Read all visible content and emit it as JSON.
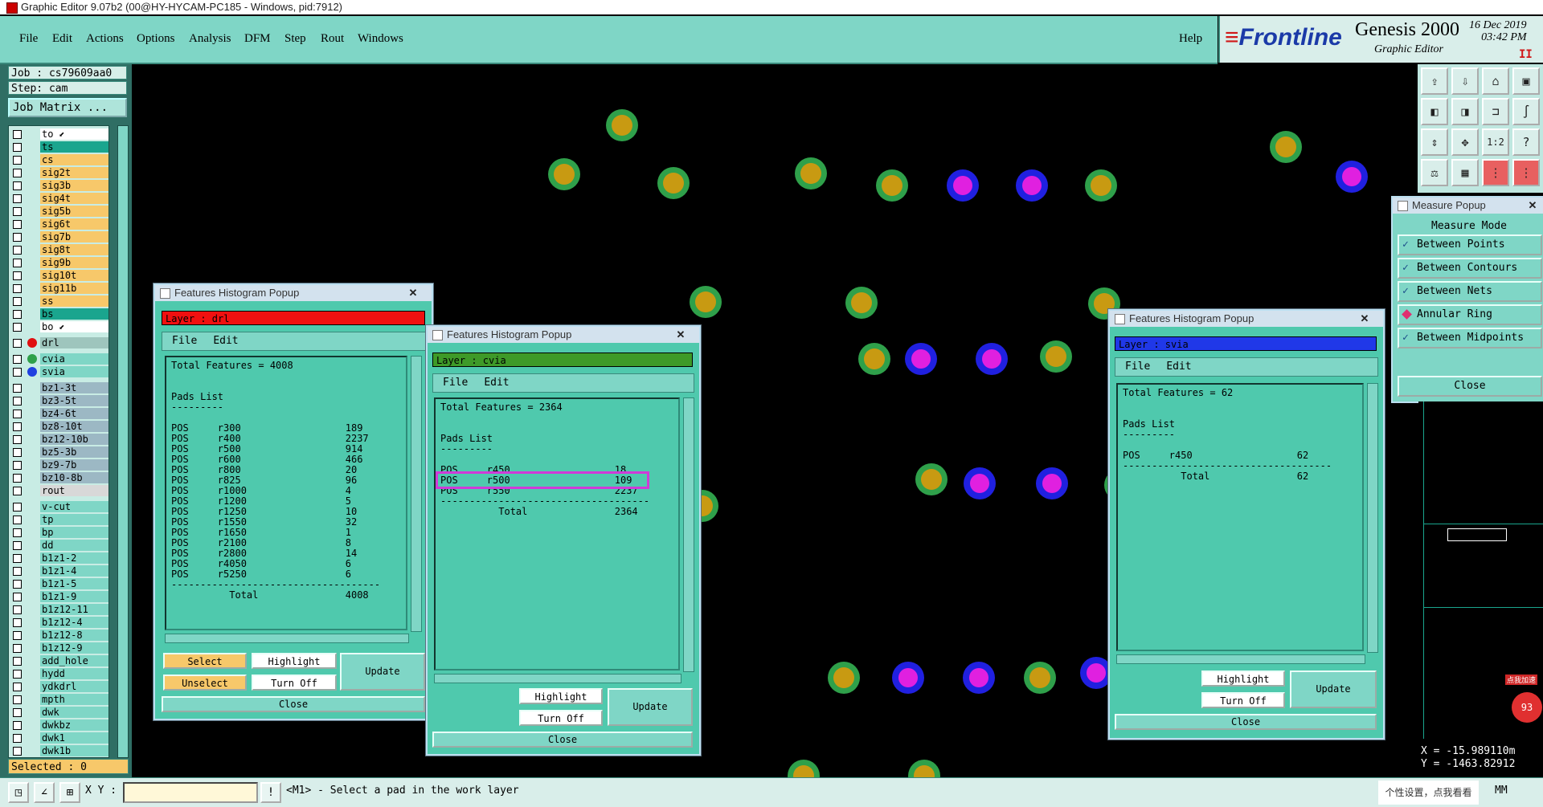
{
  "window": {
    "title": "Graphic Editor 9.07b2 (00@HY-HYCAM-PC185 - Windows, pid:7912)"
  },
  "menu": {
    "items": [
      "File",
      "Edit",
      "Actions",
      "Options",
      "Analysis",
      "DFM",
      "Step",
      "Rout",
      "Windows"
    ],
    "help": "Help"
  },
  "brand": {
    "logo": "Frontline",
    "product": "Genesis 2000",
    "subtitle": "Graphic Editor",
    "date": "16 Dec 2019",
    "time": "03:42 PM"
  },
  "left": {
    "job": "Job : cs79609aa0",
    "step": "Step: cam",
    "job_matrix": "Job Matrix ...",
    "selected": "Selected : 0",
    "layers": [
      {
        "name": "to",
        "bg": "#ffffff",
        "mark": true
      },
      {
        "name": "ts",
        "bg": "#1aa58e"
      },
      {
        "name": "cs",
        "bg": "#f7c86a"
      },
      {
        "name": "sig2t",
        "bg": "#f7c86a"
      },
      {
        "name": "sig3b",
        "bg": "#f7c86a"
      },
      {
        "name": "sig4t",
        "bg": "#f7c86a"
      },
      {
        "name": "sig5b",
        "bg": "#f7c86a"
      },
      {
        "name": "sig6t",
        "bg": "#f7c86a"
      },
      {
        "name": "sig7b",
        "bg": "#f7c86a"
      },
      {
        "name": "sig8t",
        "bg": "#f7c86a"
      },
      {
        "name": "sig9b",
        "bg": "#f7c86a"
      },
      {
        "name": "sig10t",
        "bg": "#f7c86a"
      },
      {
        "name": "sig11b",
        "bg": "#f7c86a"
      },
      {
        "name": "ss",
        "bg": "#f7c86a"
      },
      {
        "name": "bs",
        "bg": "#1aa58e"
      },
      {
        "name": "bo",
        "bg": "#ffffff",
        "mark": true
      },
      {
        "name": "drl",
        "bg": "#9ec5bd",
        "dot": "#e01010",
        "gap": true
      },
      {
        "name": "cvia",
        "bg": "#7fd6c6",
        "dot": "#2fa04a",
        "gap": true
      },
      {
        "name": "svia",
        "bg": "#7fd6c6",
        "dot": "#2040e0"
      },
      {
        "name": "bz1-3t",
        "bg": "#9cb8c4",
        "gap": true
      },
      {
        "name": "bz3-5t",
        "bg": "#9cb8c4"
      },
      {
        "name": "bz4-6t",
        "bg": "#9cb8c4"
      },
      {
        "name": "bz8-10t",
        "bg": "#9cb8c4"
      },
      {
        "name": "bz12-10b",
        "bg": "#9cb8c4"
      },
      {
        "name": "bz5-3b",
        "bg": "#9cb8c4"
      },
      {
        "name": "bz9-7b",
        "bg": "#9cb8c4"
      },
      {
        "name": "bz10-8b",
        "bg": "#9cb8c4"
      },
      {
        "name": "rout",
        "bg": "#d8d8d8"
      },
      {
        "name": "v-cut",
        "bg": "#7fd6c6",
        "gap": true
      },
      {
        "name": "tp",
        "bg": "#7fd6c6"
      },
      {
        "name": "bp",
        "bg": "#7fd6c6"
      },
      {
        "name": "dd",
        "bg": "#7fd6c6"
      },
      {
        "name": "b1z1-2",
        "bg": "#7fd6c6"
      },
      {
        "name": "b1z1-4",
        "bg": "#7fd6c6"
      },
      {
        "name": "b1z1-5",
        "bg": "#7fd6c6"
      },
      {
        "name": "b1z1-9",
        "bg": "#7fd6c6"
      },
      {
        "name": "b1z12-11",
        "bg": "#7fd6c6"
      },
      {
        "name": "b1z12-4",
        "bg": "#7fd6c6"
      },
      {
        "name": "b1z12-8",
        "bg": "#7fd6c6"
      },
      {
        "name": "b1z12-9",
        "bg": "#7fd6c6"
      },
      {
        "name": "add_hole",
        "bg": "#7fd6c6"
      },
      {
        "name": "hydd",
        "bg": "#7fd6c6"
      },
      {
        "name": "ydkdrl",
        "bg": "#7fd6c6"
      },
      {
        "name": "mpth",
        "bg": "#7fd6c6"
      },
      {
        "name": "dwk",
        "bg": "#7fd6c6"
      },
      {
        "name": "dwkbz",
        "bg": "#7fd6c6"
      },
      {
        "name": "dwk1",
        "bg": "#7fd6c6"
      },
      {
        "name": "dwk1b",
        "bg": "#7fd6c6"
      }
    ]
  },
  "popup1": {
    "title": "Features Histogram Popup",
    "layer": "Layer :  drl",
    "menu": [
      "File",
      "Edit"
    ],
    "total": "Total Features = 4008",
    "pads_head": "Pads List",
    "rows": [
      [
        "POS",
        "r300",
        "189"
      ],
      [
        "POS",
        "r400",
        "2237"
      ],
      [
        "POS",
        "r500",
        "914"
      ],
      [
        "POS",
        "r600",
        "466"
      ],
      [
        "POS",
        "r800",
        "20"
      ],
      [
        "POS",
        "r825",
        "96"
      ],
      [
        "POS",
        "r1000",
        "4"
      ],
      [
        "POS",
        "r1200",
        "5"
      ],
      [
        "POS",
        "r1250",
        "10"
      ],
      [
        "POS",
        "r1550",
        "32"
      ],
      [
        "POS",
        "r1650",
        "1"
      ],
      [
        "POS",
        "r2100",
        "8"
      ],
      [
        "POS",
        "r2800",
        "14"
      ],
      [
        "POS",
        "r4050",
        "6"
      ],
      [
        "POS",
        "r5250",
        "6"
      ]
    ],
    "total_label": "Total",
    "total_value": "4008",
    "buttons": {
      "select": "Select",
      "unselect": "Unselect",
      "highlight": "Highlight",
      "turn_off": "Turn Off",
      "update": "Update",
      "close": "Close"
    }
  },
  "popup2": {
    "title": "Features Histogram Popup",
    "layer": "Layer :  cvia",
    "menu": [
      "File",
      "Edit"
    ],
    "total": "Total Features = 2364",
    "pads_head": "Pads List",
    "rows": [
      [
        "POS",
        "r450",
        "18"
      ],
      [
        "POS",
        "r500",
        "109"
      ],
      [
        "POS",
        "r550",
        "2237"
      ]
    ],
    "total_label": "Total",
    "total_value": "2364",
    "buttons": {
      "highlight": "Highlight",
      "turn_off": "Turn Off",
      "update": "Update",
      "close": "Close"
    }
  },
  "popup3": {
    "title": "Features Histogram Popup",
    "layer": "Layer :  svia",
    "menu": [
      "File",
      "Edit"
    ],
    "total": "Total Features = 62",
    "pads_head": "Pads List",
    "rows": [
      [
        "POS",
        "r450",
        "62"
      ]
    ],
    "total_label": "Total",
    "total_value": "62",
    "buttons": {
      "highlight": "Highlight",
      "turn_off": "Turn Off",
      "update": "Update",
      "close": "Close"
    }
  },
  "measure": {
    "title": "Measure Popup",
    "mode": "Measure Mode",
    "options": [
      "Between Points",
      "Between Contours",
      "Between Nets",
      "Annular Ring",
      "Between Midpoints"
    ],
    "close": "Close"
  },
  "coords": {
    "x": "X = -15.989110m",
    "y": "Y = -1463.82912"
  },
  "status": {
    "xy_label": "X Y :",
    "message": "<M1> - Select a pad in the work layer",
    "promo": "个性设置，点我看看",
    "badge": "点我加速",
    "unit": "MM"
  },
  "colors": {
    "teal": "#7fd6c6",
    "panel": "#4fc9ad",
    "amber": "#f7c86a",
    "pad_green": "#2fa04a",
    "pad_gold": "#c89a12",
    "pad_blue": "#2020e0",
    "pad_magenta": "#e020e0"
  }
}
